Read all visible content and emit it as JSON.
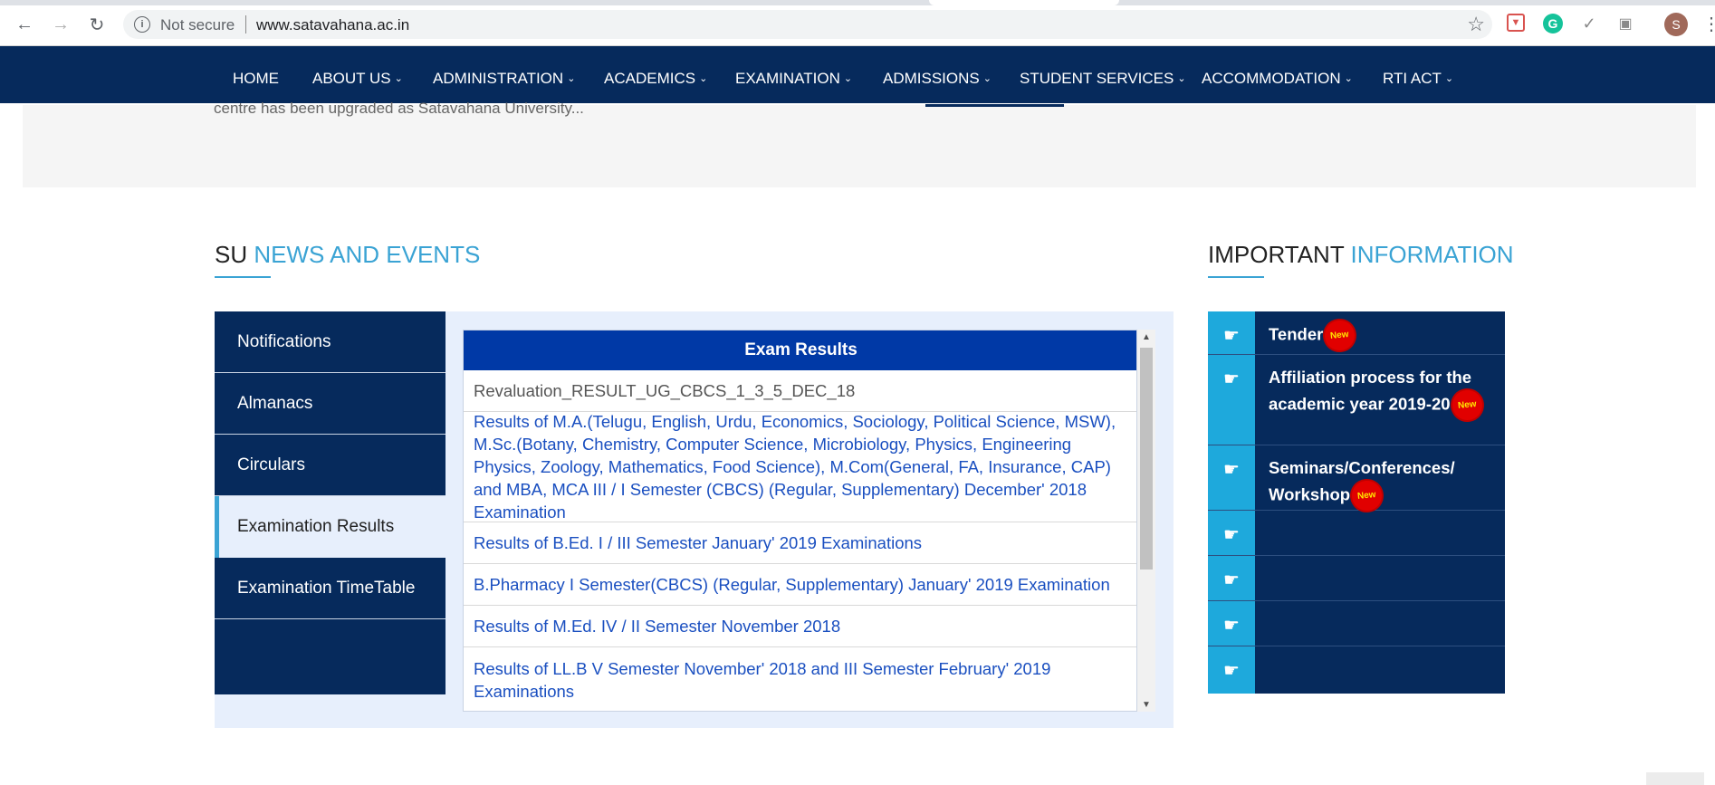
{
  "browser": {
    "security_label": "Not secure",
    "url": "www.satavahana.ac.in",
    "avatar_letter": "S",
    "icons": [
      "back-arrow-icon",
      "forward-arrow-icon",
      "reload-icon",
      "info-icon",
      "star-icon",
      "extension-icon",
      "grammarly-icon",
      "check-icon",
      "camera-icon"
    ]
  },
  "nav": {
    "items": [
      {
        "label": "HOME",
        "dropdown": false
      },
      {
        "label": "ABOUT US",
        "dropdown": true
      },
      {
        "label": "ADMINISTRATION",
        "dropdown": true
      },
      {
        "label": "ACADEMICS",
        "dropdown": true
      },
      {
        "label": "EXAMINATION",
        "dropdown": true
      },
      {
        "label": "ADMISSIONS",
        "dropdown": true
      },
      {
        "label": "STUDENT SERVICES",
        "dropdown": true
      },
      {
        "label": "ACCOMMODATION",
        "dropdown": true
      },
      {
        "label": "RTI ACT",
        "dropdown": true
      }
    ]
  },
  "hero": {
    "text": "centre has been upgraded as Satavahana University..."
  },
  "news": {
    "title_prefix": "SU",
    "title_accent": "NEWS AND EVENTS",
    "tabs": [
      {
        "label": "Notifications",
        "active": false
      },
      {
        "label": "Almanacs",
        "active": false
      },
      {
        "label": "Circulars",
        "active": false
      },
      {
        "label": "Examination Results",
        "active": true
      },
      {
        "label": "Examination TimeTable",
        "active": false
      }
    ],
    "results_header": "Exam Results",
    "results": [
      "Revaluation_RESULT_UG_CBCS_1_3_5_DEC_18",
      "Results of M.A.(Telugu, English, Urdu, Economics, Sociology, Political Science, MSW), M.Sc.(Botany, Chemistry, Computer Science, Microbiology, Physics, Engineering Physics, Zoology, Mathematics, Food Science), M.Com(General, FA, Insurance, CAP) and MBA, MCA III / I Semester (CBCS) (Regular, Supplementary) December' 2018 Examination",
      "Results of B.Ed. I / III Semester January' 2019 Examinations",
      "B.Pharmacy I Semester(CBCS) (Regular, Supplementary) January' 2019 Examination",
      "Results of M.Ed. IV / II Semester November 2018",
      "Results of LL.B V Semester November' 2018 and III Semester February' 2019 Examinations"
    ]
  },
  "important": {
    "title_prefix": "IMPORTANT",
    "title_accent": "INFORMATION",
    "new_badge": "New",
    "items": [
      {
        "label": "Tender",
        "new": true
      },
      {
        "label": "Affiliation process for the academic year 2019-20",
        "new": true
      },
      {
        "label": "Seminars/Conferences/ Workshop",
        "new": true
      },
      {
        "label": "",
        "new": false
      },
      {
        "label": "",
        "new": false
      },
      {
        "label": "",
        "new": false
      },
      {
        "label": "",
        "new": false
      }
    ]
  },
  "colors": {
    "nav_bg": "#062a5c",
    "accent": "#3aa3d4",
    "results_header_bg": "#0039a6",
    "link": "#1a4fc0",
    "info_icon_bg": "#1ea9dc"
  }
}
